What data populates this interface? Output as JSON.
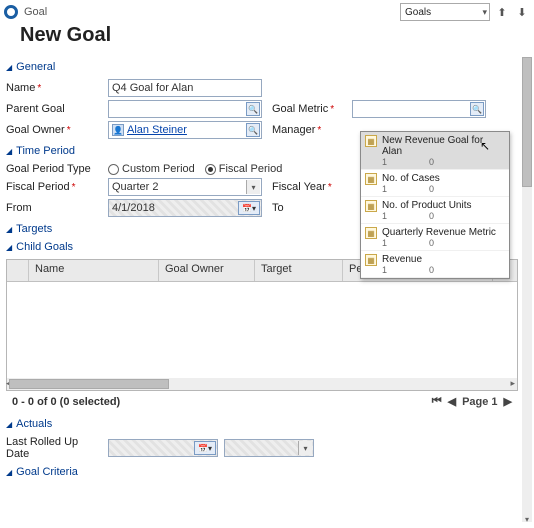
{
  "header": {
    "entity": "Goal",
    "title": "New Goal",
    "entity_selector": "Goals"
  },
  "sections": {
    "general": "General",
    "time_period": "Time Period",
    "targets": "Targets",
    "child_goals": "Child Goals",
    "actuals": "Actuals",
    "goal_criteria": "Goal Criteria"
  },
  "general": {
    "name_label": "Name",
    "name_value": "Q4 Goal for Alan",
    "parent_goal_label": "Parent Goal",
    "parent_goal_value": "",
    "goal_owner_label": "Goal Owner",
    "goal_owner_value": "Alan Steiner",
    "goal_metric_label": "Goal Metric",
    "goal_metric_value": "",
    "manager_label": "Manager"
  },
  "metric_options": [
    {
      "label": "New Revenue Goal for Alan",
      "left": "1",
      "right": "0",
      "selected": true
    },
    {
      "label": "No. of Cases",
      "left": "1",
      "right": "0"
    },
    {
      "label": "No. of Product Units",
      "left": "1",
      "right": "0"
    },
    {
      "label": "Quarterly Revenue Metric",
      "left": "1",
      "right": "0"
    },
    {
      "label": "Revenue",
      "left": "1",
      "right": "0"
    }
  ],
  "time_period": {
    "goal_period_type_label": "Goal Period Type",
    "custom_label": "Custom Period",
    "fiscal_label": "Fiscal Period",
    "fiscal_selected": true,
    "fiscal_period_label": "Fiscal Period",
    "fiscal_period_value": "Quarter 2",
    "fiscal_year_label": "Fiscal Year",
    "from_label": "From",
    "from_value": "4/1/2018",
    "to_label": "To"
  },
  "grid": {
    "headers": [
      "Name",
      "Goal Owner",
      "Target",
      "Percentage Achieved"
    ],
    "footer_status": "0 - 0 of 0 (0 selected)",
    "page_label": "Page 1"
  },
  "actuals": {
    "last_rolled_label": "Last Rolled Up Date"
  }
}
